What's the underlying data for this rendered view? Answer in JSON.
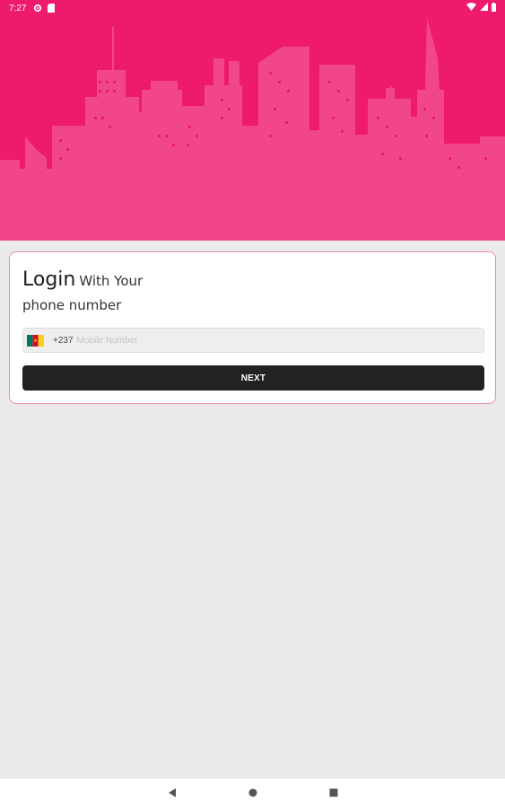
{
  "status_bar": {
    "time": "7:27",
    "left_icons": [
      "gear-icon",
      "sd-card-icon"
    ],
    "right_icons": [
      "wifi-icon",
      "signal-icon",
      "battery-icon"
    ]
  },
  "header": {
    "background_color": "#ee1a6b",
    "illustration": "city-skyline-icon"
  },
  "login": {
    "title": "Login",
    "title_suffix": "With Your",
    "subtitle": "phone number",
    "country_flag": "cameroon-flag-icon",
    "country_code": "+237",
    "phone_value": "",
    "phone_placeholder": "Mobile Number",
    "next_label": "NEXT"
  },
  "nav_bar": {
    "buttons": [
      "back-icon",
      "home-icon",
      "recents-icon"
    ]
  },
  "colors": {
    "accent": "#ee1a6b",
    "card_border": "#ec8aae",
    "button": "#222222",
    "page_background": "#ecebe9"
  }
}
